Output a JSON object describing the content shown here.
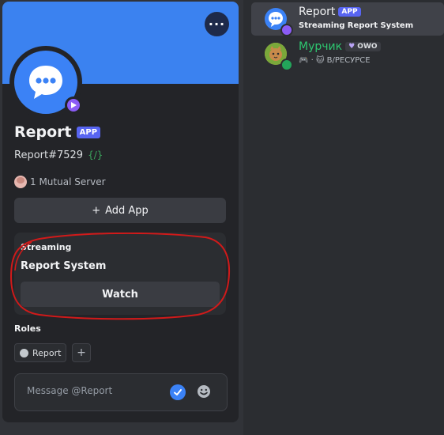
{
  "profile": {
    "display_name": "Report",
    "badge": "APP",
    "username": "Report#7529",
    "code_tag": "{/}",
    "mutual_servers": "1 Mutual Server",
    "add_app_label": "Add App"
  },
  "streaming": {
    "label": "Streaming",
    "title": "Report System",
    "watch_label": "Watch"
  },
  "roles": {
    "label": "Roles",
    "items": [
      "Report"
    ]
  },
  "message": {
    "placeholder": "Message @Report"
  },
  "members": [
    {
      "name": "Report",
      "badge": "APP",
      "activity_prefix": "Streaming",
      "activity_title": "Report System",
      "status": "streaming"
    },
    {
      "name": "Мурчик",
      "badge": "OWO",
      "activity": "В/РЕСУРСЕ",
      "status": "online"
    }
  ],
  "colors": {
    "banner": "#3b82f0",
    "app_badge": "#5865f2",
    "streaming_status": "#8b5cf6",
    "online_status": "#23a55a",
    "member_name_green": "#2dc770",
    "annotation_red": "#d11a1a"
  }
}
